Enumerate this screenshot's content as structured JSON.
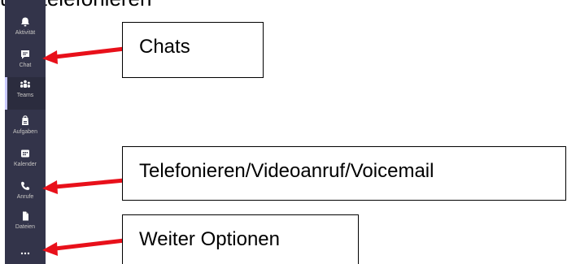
{
  "heading_fragment": "und telefonieren",
  "sidebar": {
    "items": [
      {
        "id": "aktivitat",
        "label": "Aktivität",
        "icon": "bell-icon"
      },
      {
        "id": "chat",
        "label": "Chat",
        "icon": "chat-icon"
      },
      {
        "id": "teams",
        "label": "Teams",
        "icon": "teams-icon"
      },
      {
        "id": "aufgaben",
        "label": "Aufgaben",
        "icon": "tasks-icon"
      },
      {
        "id": "kalender",
        "label": "Kalender",
        "icon": "calendar-icon"
      },
      {
        "id": "anrufe",
        "label": "Anrufe",
        "icon": "phone-icon"
      },
      {
        "id": "dateien",
        "label": "Dateien",
        "icon": "file-icon"
      },
      {
        "id": "more",
        "label": "",
        "icon": "more-icon"
      }
    ],
    "active": "teams"
  },
  "callouts": {
    "chats": "Chats",
    "calls": "Telefonieren/Videoanruf/Voicemail",
    "more": "Weiter Optionen"
  },
  "colors": {
    "sidebar_bg": "#33344a",
    "sidebar_text": "#c8c6c4",
    "arrow": "#e8101a",
    "active_accent": "#c8c8ff"
  }
}
